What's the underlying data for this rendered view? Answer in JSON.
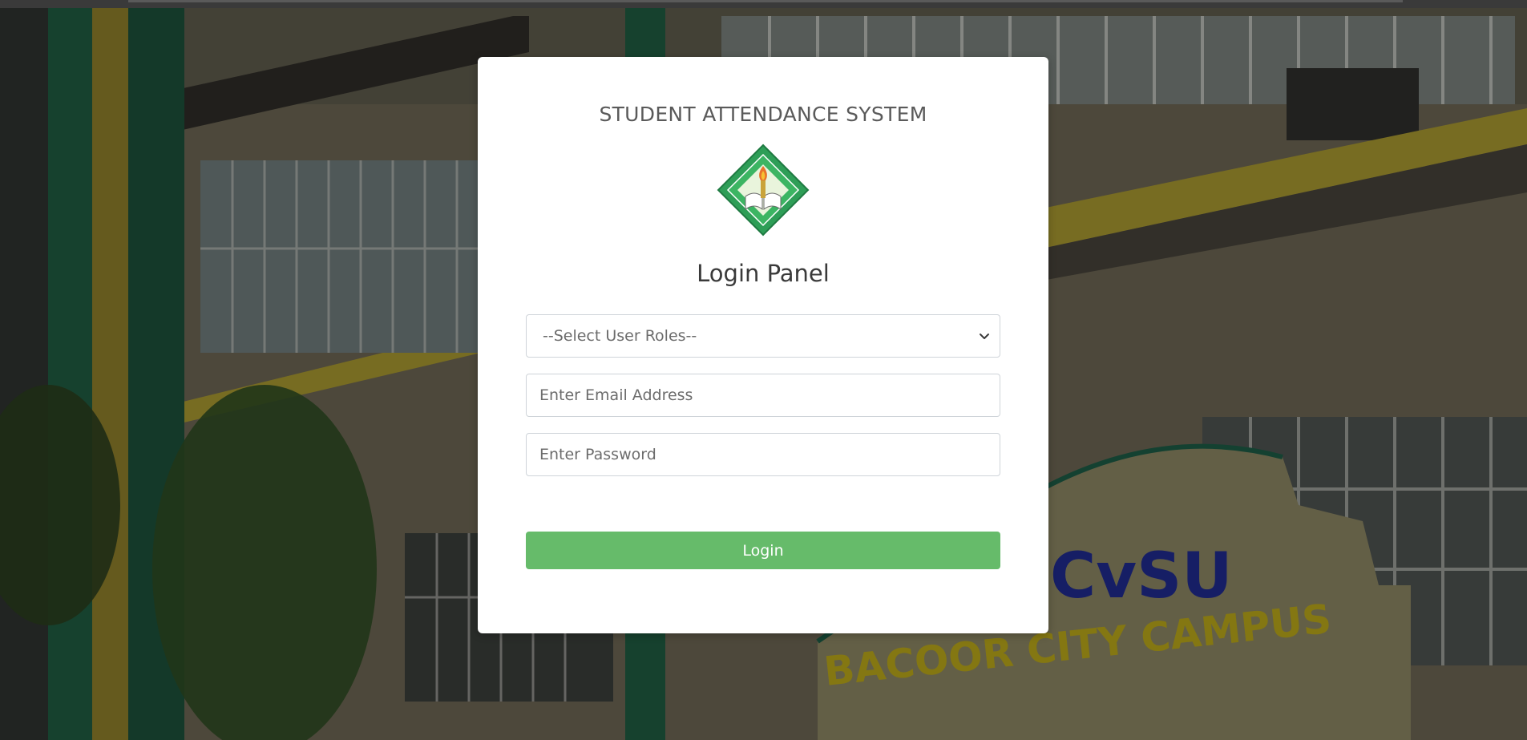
{
  "app": {
    "system_title": "STUDENT ATTENDANCE SYSTEM",
    "panel_title": "Login Panel"
  },
  "form": {
    "role_select": {
      "selected": "--Select User Roles--"
    },
    "email": {
      "value": "",
      "placeholder": "Enter Email Address"
    },
    "password": {
      "value": "",
      "placeholder": "Enter Password"
    },
    "login_label": "Login"
  },
  "background": {
    "sign_line1": "CvSU",
    "sign_line2": "BACOOR CITY CAMPUS"
  },
  "colors": {
    "login_button": "#66bb6a",
    "logo_green": "#2e9e57",
    "sign_blue": "#1f2a8c",
    "sign_yellow": "#d8c21a"
  },
  "icons": {
    "logo": "university-seal-icon",
    "dropdown": "chevron-down-icon"
  }
}
